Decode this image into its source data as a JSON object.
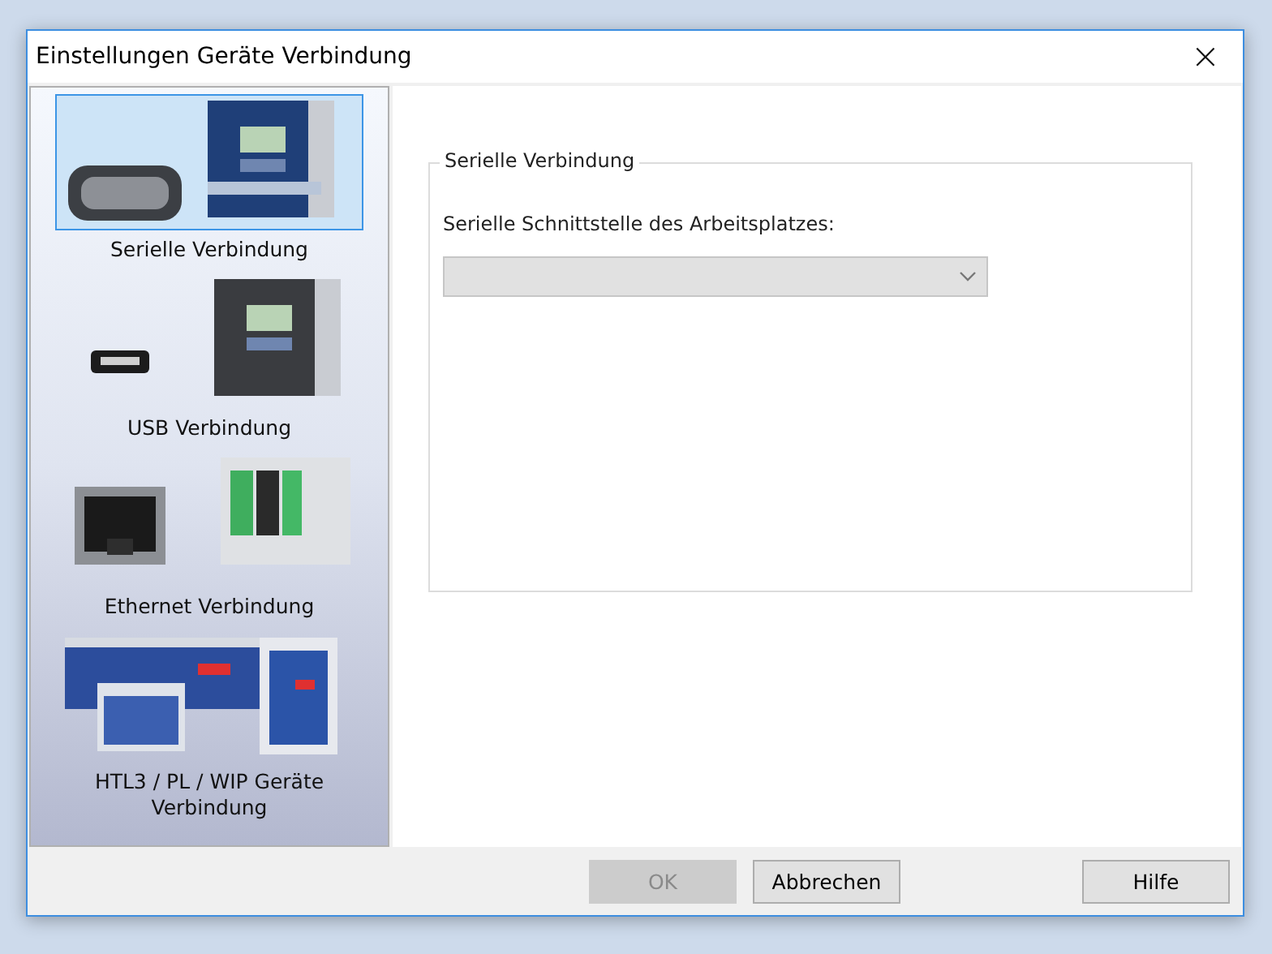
{
  "window": {
    "title": "Einstellungen Geräte Verbindung",
    "close": "×"
  },
  "sidebar": {
    "items": [
      {
        "label": "Serielle Verbindung",
        "selected": true
      },
      {
        "label": "USB Verbindung",
        "selected": false
      },
      {
        "label": "Ethernet Verbindung",
        "selected": false
      },
      {
        "label": "HTL3 / PL / WIP Geräte Verbindung",
        "selected": false
      }
    ]
  },
  "group": {
    "title": "Serielle Verbindung",
    "field_label": "Serielle Schnittstelle des Arbeitsplatzes:",
    "select": {
      "disabled": true
    }
  },
  "buttons": [
    {
      "label": "OK",
      "disabled": true
    },
    {
      "label": "Abbrechen",
      "disabled": false
    },
    {
      "label": "Hilfe",
      "disabled": false
    }
  ]
}
